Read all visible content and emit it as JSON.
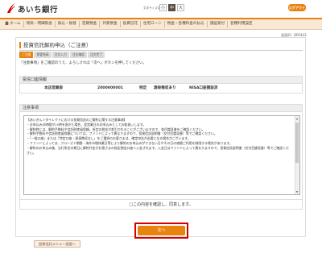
{
  "header": {
    "bank_name": "あいち銀行",
    "font_size_label": "文字サイズ変更",
    "font_sizes": [
      "小",
      "中",
      "大"
    ],
    "logout_label": "ログアウト"
  },
  "nav": {
    "items": [
      "ホーム",
      "残高・明細照会",
      "振込・振替",
      "定期預金",
      "外貨預金",
      "投資信託",
      "住宅ローン",
      "税金・各種料金の払込",
      "諸届受付",
      "各種利用設定"
    ]
  },
  "screen_id": "画面ID：BP0403",
  "page_title": "投資信託解約申込（ご注意）",
  "steps": [
    "ご注意",
    "保管残高",
    "注文入力",
    "注文確認",
    "注文完了"
  ],
  "instruction": "「注意事項」をご確認のうえ、よろしければ「次へ」ボタンを押してください。",
  "account": {
    "section_title": "投信口座情報",
    "branch": "本店営業部",
    "number": "2000000001",
    "type": "特定",
    "withholding": "源泉徴収あり",
    "nisa": "NISA口座開設済"
  },
  "notes": {
    "section_title": "注意事項",
    "text": "【あいぎん＞ダイレクトにおける投資信託のご解約に関する注意事項】\n・お申込みの時間が15時を過ぎた場合、翌営業日のお申込みとしてお取扱いします。\n・解約時には、解約手数料や信託財産留保額、所定の税金が差引かれることがございますので、各目論見書をご確認ください。\n・解約手数料や信託財産留保額については、ファンドによって異なりますので、投資信託説明書（交付目論見書）等でご確認ください。\n・「一般口座」または「特定口座・源泉徴収なし」をご選択のお客さまは、確定申告が必要となる場合がございます。\n・ファンドによっては、クローズド期間・海外市場休業日等により解約のお申込みができない日やその日の夜間ご利用を制限する場合があります。\n・解約のお申込み後、当行所定の期日に解約代金がお客さまの指定預金口座へ入金されます。入金日はファンドによって異なりますので、投資信託説明書（交付目論見書）等でご確認ください。"
  },
  "confirm_label": "□この内容を確認し、同意します。",
  "next_label": "次へ",
  "back_label": "投資信託メニュー画面へ",
  "colors": {
    "accent": "#e8830f",
    "highlight": "#d40000",
    "nav_bg": "#f8e8d6"
  }
}
